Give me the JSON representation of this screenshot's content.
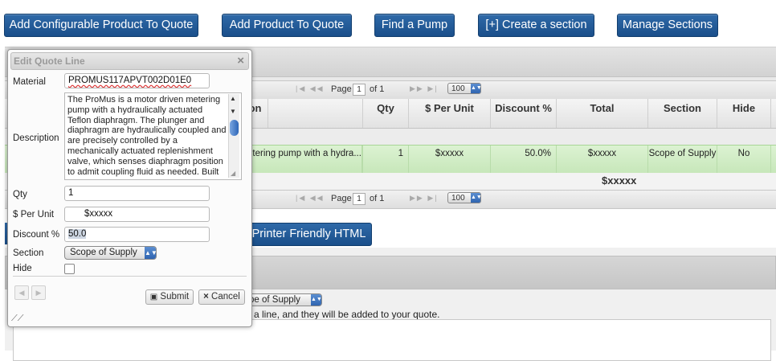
{
  "toolbar": {
    "buttons": [
      "Add Configurable Product To Quote",
      "Add Product To Quote",
      "Find a Pump",
      "[+] Create a section",
      "Manage Sections"
    ]
  },
  "grid": {
    "pager": {
      "page_label": "Page",
      "page_value": "1",
      "of_label": "of 1",
      "page_size": "100"
    },
    "columns": {
      "description_partial": "ion",
      "qty": "Qty",
      "per_unit": "$ Per Unit",
      "discount": "Discount %",
      "total": "Total",
      "section": "Section",
      "hide": "Hide"
    },
    "row": {
      "description": "etering pump with a hydra...",
      "qty": "1",
      "per_unit": "$xxxxx",
      "discount": "50.0%",
      "total": "$xxxxx",
      "section": "Scope of Supply",
      "hide": "No"
    },
    "footer_total": "$xxxxx",
    "footer_pager_partial": "n"
  },
  "printer_button": "Printer Friendly HTML",
  "section_panel": {
    "select_value": "pe of Supply",
    "hint": "a line, and they will be added to your quote."
  },
  "dialog": {
    "title": "Edit Quote Line",
    "material_label": "Material",
    "material_value": "PROMUS117APVT002D01E0",
    "description_label": "Description",
    "description_value": "The ProMus is a motor driven metering pump with a hydraulically actuated Teflon diaphragm. The plunger and diaphragm are hydraulically coupled and are precisely controlled by a mechanically actuated replenishment valve, which senses diaphragm position to admit coupling fluid as needed. Built",
    "qty_label": "Qty",
    "qty_value": "1",
    "per_unit_label": "$ Per Unit",
    "per_unit_value": "$xxxxx",
    "discount_label": "Discount %",
    "discount_value": "50.0",
    "section_label": "Section",
    "section_value": "Scope of Supply",
    "hide_label": "Hide",
    "hide_checked": false,
    "submit_label": "Submit",
    "cancel_label": "Cancel"
  },
  "colors": {
    "button_blue": "#1f5a96",
    "row_green": "#c7e7ba",
    "select_arrow_blue": "#2f64b0"
  }
}
